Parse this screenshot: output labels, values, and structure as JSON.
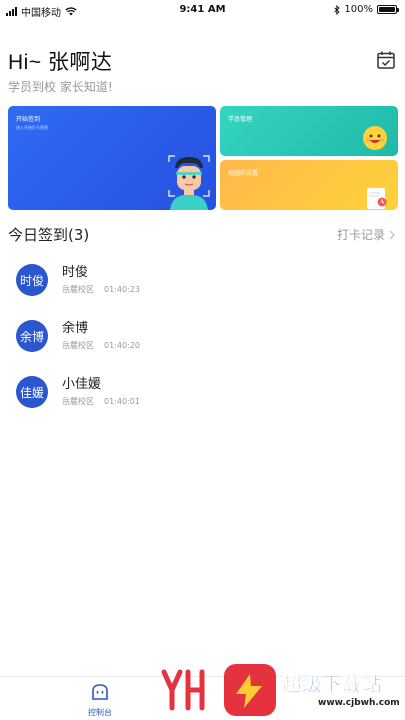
{
  "status_bar": {
    "carrier": "中国移动",
    "time": "9:41 AM",
    "battery": "100%",
    "battery_level": 1.0
  },
  "header": {
    "greeting": "Hi~ 张啊达",
    "subtitle": "学员到校 家长知道!",
    "calendar_icon": "calendar-check-icon"
  },
  "cards": {
    "checkin": {
      "title": "开始签到",
      "subtitle": "进入开始打卡签到"
    },
    "students": {
      "title": "学员管理"
    },
    "manage": {
      "title": "校园的设置"
    }
  },
  "today": {
    "title": "今日签到(3)",
    "records_link": "打卡记录",
    "students": [
      {
        "avatar": "时俊",
        "name": "时俊",
        "campus": "岳麓校区",
        "time": "01:40:23"
      },
      {
        "avatar": "余博",
        "name": "余博",
        "campus": "岳麓校区",
        "time": "01:40:20"
      },
      {
        "avatar": "佳媛",
        "name": "小佳媛",
        "campus": "岳麓校区",
        "time": "01:40:01"
      }
    ]
  },
  "tab_bar": {
    "items": [
      {
        "label": "控制台",
        "icon": "console-icon",
        "active": true
      }
    ]
  },
  "watermark": {
    "text": "超级下载站",
    "url": "www.cjbwh.com"
  },
  "colors": {
    "primary": "#2a56cf",
    "card_blue": "#2f6bf3",
    "card_teal": "#2ec9b5",
    "card_orange": "#ffc344"
  }
}
